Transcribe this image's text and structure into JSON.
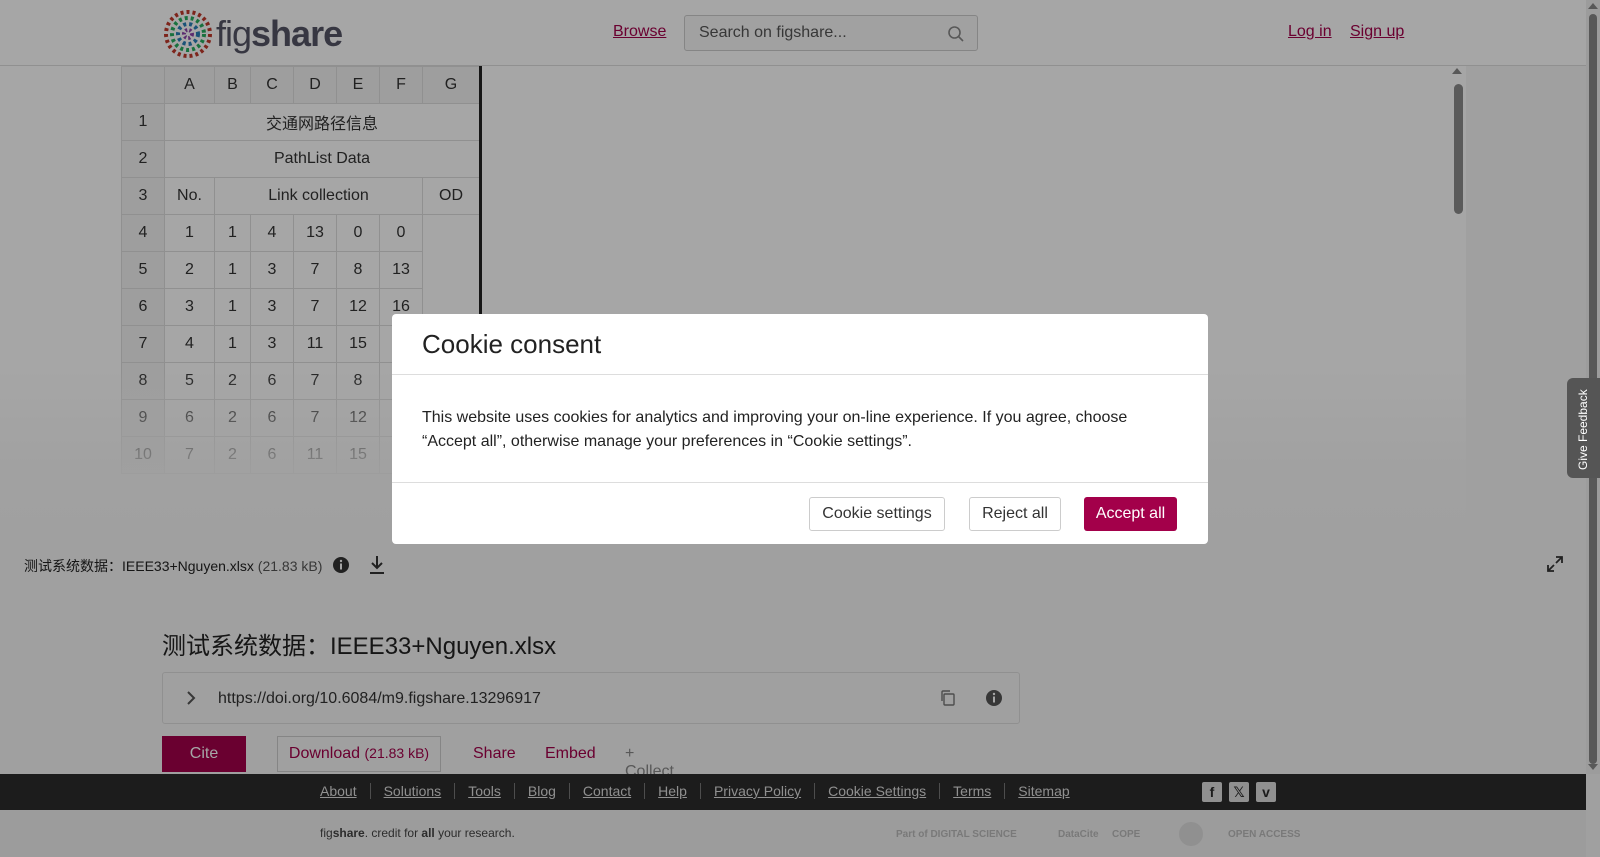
{
  "header": {
    "logo_text_fig": "fig",
    "logo_text_share": "share",
    "browse": "Browse",
    "search_placeholder": "Search on figshare...",
    "login": "Log in",
    "signup": "Sign up"
  },
  "sheet": {
    "col_headers": [
      "",
      "A",
      "B",
      "C",
      "D",
      "E",
      "F",
      "G"
    ],
    "row1": {
      "num": "1",
      "text": "交通网路径信息"
    },
    "row2": {
      "num": "2",
      "text": "PathList Data"
    },
    "row3": {
      "num": "3",
      "no": "No.",
      "link": "Link collection",
      "od": "OD"
    },
    "data_rows": [
      [
        "4",
        "1",
        "1",
        "4",
        "13",
        "0",
        "0"
      ],
      [
        "5",
        "2",
        "1",
        "3",
        "7",
        "8",
        "13"
      ],
      [
        "6",
        "3",
        "1",
        "3",
        "7",
        "12",
        "16"
      ],
      [
        "7",
        "4",
        "1",
        "3",
        "11",
        "15",
        ""
      ],
      [
        "8",
        "5",
        "2",
        "6",
        "7",
        "8",
        ""
      ],
      [
        "9",
        "6",
        "2",
        "6",
        "7",
        "12",
        ""
      ],
      [
        "10",
        "7",
        "2",
        "6",
        "11",
        "15",
        ""
      ]
    ]
  },
  "file_bar": {
    "name": "测试系统数据：IEEE33+Nguyen.xlsx",
    "size": "(21.83 kB)"
  },
  "main": {
    "title": "测试系统数据：IEEE33+Nguyen.xlsx",
    "doi": "https://doi.org/10.6084/m9.figshare.13296917",
    "cite": "Cite",
    "download": "Download",
    "download_size": "(21.83 kB)",
    "share": "Share",
    "embed": "Embed",
    "collect": "+ Collect"
  },
  "footer": {
    "links": [
      "About",
      "Solutions",
      "Tools",
      "Blog",
      "Contact",
      "Help",
      "Privacy Policy",
      "Cookie Settings",
      "Terms",
      "Sitemap"
    ],
    "credit_fig": "fig",
    "credit_share": "share",
    "credit_mid": ". credit for ",
    "credit_all": "all",
    "credit_end": " your research.",
    "partners": [
      "Part of DIGITAL SCIENCE",
      "DataCite",
      "COPE",
      "OPEN ACCESS"
    ]
  },
  "feedback": "Give Feedback",
  "modal": {
    "title": "Cookie consent",
    "body": "This website uses cookies for analytics and improving your on-line experience. If you agree, choose “Accept all”, otherwise manage your preferences in “Cookie settings”.",
    "cookie_settings": "Cookie settings",
    "reject_all": "Reject all",
    "accept_all": "Accept all"
  },
  "colors": {
    "brand": "#a3004a",
    "footer_bg": "#2b2b2b"
  },
  "icons": [
    "search-icon",
    "info-icon",
    "download-icon",
    "expand-icon",
    "chevron-right-icon",
    "copy-icon",
    "facebook-icon",
    "x-icon",
    "vimeo-icon"
  ]
}
